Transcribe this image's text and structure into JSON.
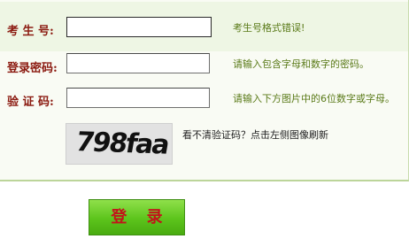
{
  "form": {
    "candidate_no": {
      "label": "考 生 号:",
      "value": "",
      "error": "考生号格式错误!"
    },
    "password": {
      "label": "登录密码:",
      "value": "",
      "hint": "请输入包含字母和数字的密码。"
    },
    "verify": {
      "label": "验 证 码:",
      "value": "",
      "hint": "请输入下方图片中的6位数字或字母。"
    },
    "captcha": {
      "image_text": "798faa",
      "refresh_text": "看不清验证码？点击左侧图像刷新"
    },
    "submit_label": "登 录"
  },
  "colors": {
    "label": "#8b1a10",
    "hint": "#5a7a18",
    "error_row_bg": "#eef6e4",
    "panel_bg": "#f9fbf4",
    "button_green": "#5cc41c",
    "button_text": "#c2141a"
  }
}
